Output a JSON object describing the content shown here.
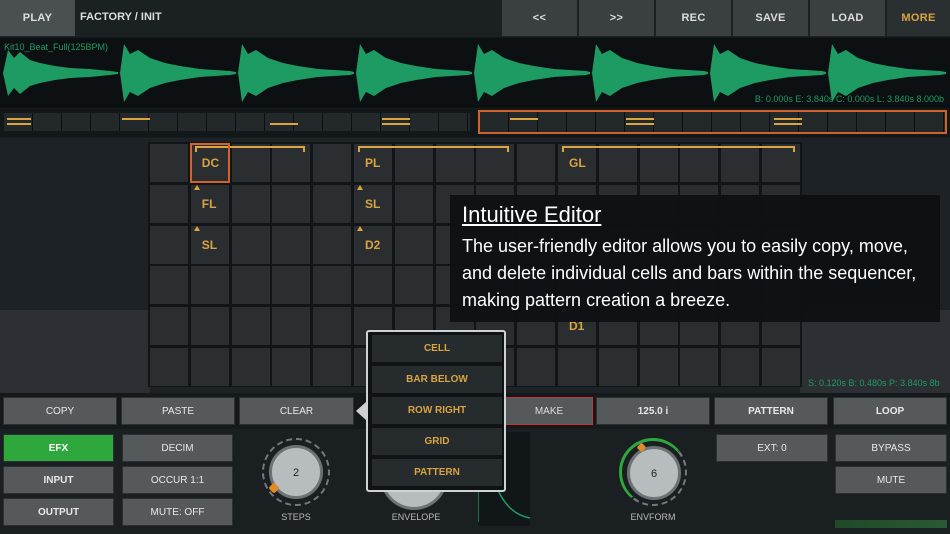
{
  "topbar": {
    "play": "PLAY",
    "preset": "FACTORY / INIT",
    "prev": "<<",
    "next": ">>",
    "rec": "REC",
    "save": "SAVE",
    "load": "LOAD",
    "more": "MORE"
  },
  "waveform": {
    "title": "Kit10_Beat_Full(125BPM)",
    "info": "B: 0.000s E: 3.840s C: 0.000s L: 3.840s 8.000b",
    "color": "#1e9a63"
  },
  "grid": {
    "columns": 16,
    "rows": 6,
    "labels": [
      {
        "text": "DC",
        "col": 1,
        "row": 0,
        "selected": true
      },
      {
        "text": "FL",
        "col": 1,
        "row": 1
      },
      {
        "text": "SL",
        "col": 1,
        "row": 2
      },
      {
        "text": "PL",
        "col": 5,
        "row": 0
      },
      {
        "text": "SL",
        "col": 5,
        "row": 1
      },
      {
        "text": "D2",
        "col": 5,
        "row": 2
      },
      {
        "text": "GL",
        "col": 10,
        "row": 0
      },
      {
        "text": "D1",
        "col": 10,
        "row": 4
      }
    ],
    "info": "S: 0.120s B: 0.480s P: 3.840s 8b"
  },
  "callout": {
    "title": "Intuitive Editor",
    "body": "The user-friendly editor allows you to easily copy, move, and delete individual cells and bars within the sequencer, making pattern creation a breeze."
  },
  "toolbar": {
    "copy": "COPY",
    "paste": "PASTE",
    "clear": "CLEAR",
    "make": "MAKE",
    "tempo": "125.0 i",
    "pattern": "PATTERN",
    "loop": "LOOP"
  },
  "menu": {
    "items": [
      "CELL",
      "BAR BELOW",
      "ROW RIGHT",
      "GRID",
      "PATTERN"
    ]
  },
  "left": {
    "efx": "EFX",
    "input": "INPUT",
    "output": "OUTPUT",
    "decim": "DECIM",
    "occur": "OCCUR 1:1",
    "mute": "MUTE: OFF"
  },
  "knobs": [
    {
      "label": "STEPS",
      "value": "2"
    },
    {
      "label": "ENVELOPE",
      "value": ""
    },
    {
      "label": "ENVFORM",
      "value": "6"
    }
  ],
  "right": {
    "ext": "EXT: 0",
    "bypass": "BYPASS",
    "mute": "MUTE"
  },
  "colors": {
    "accent": "#d9a441",
    "select": "#d0622a",
    "green": "#2a9f3a",
    "panel": "#55595b"
  }
}
